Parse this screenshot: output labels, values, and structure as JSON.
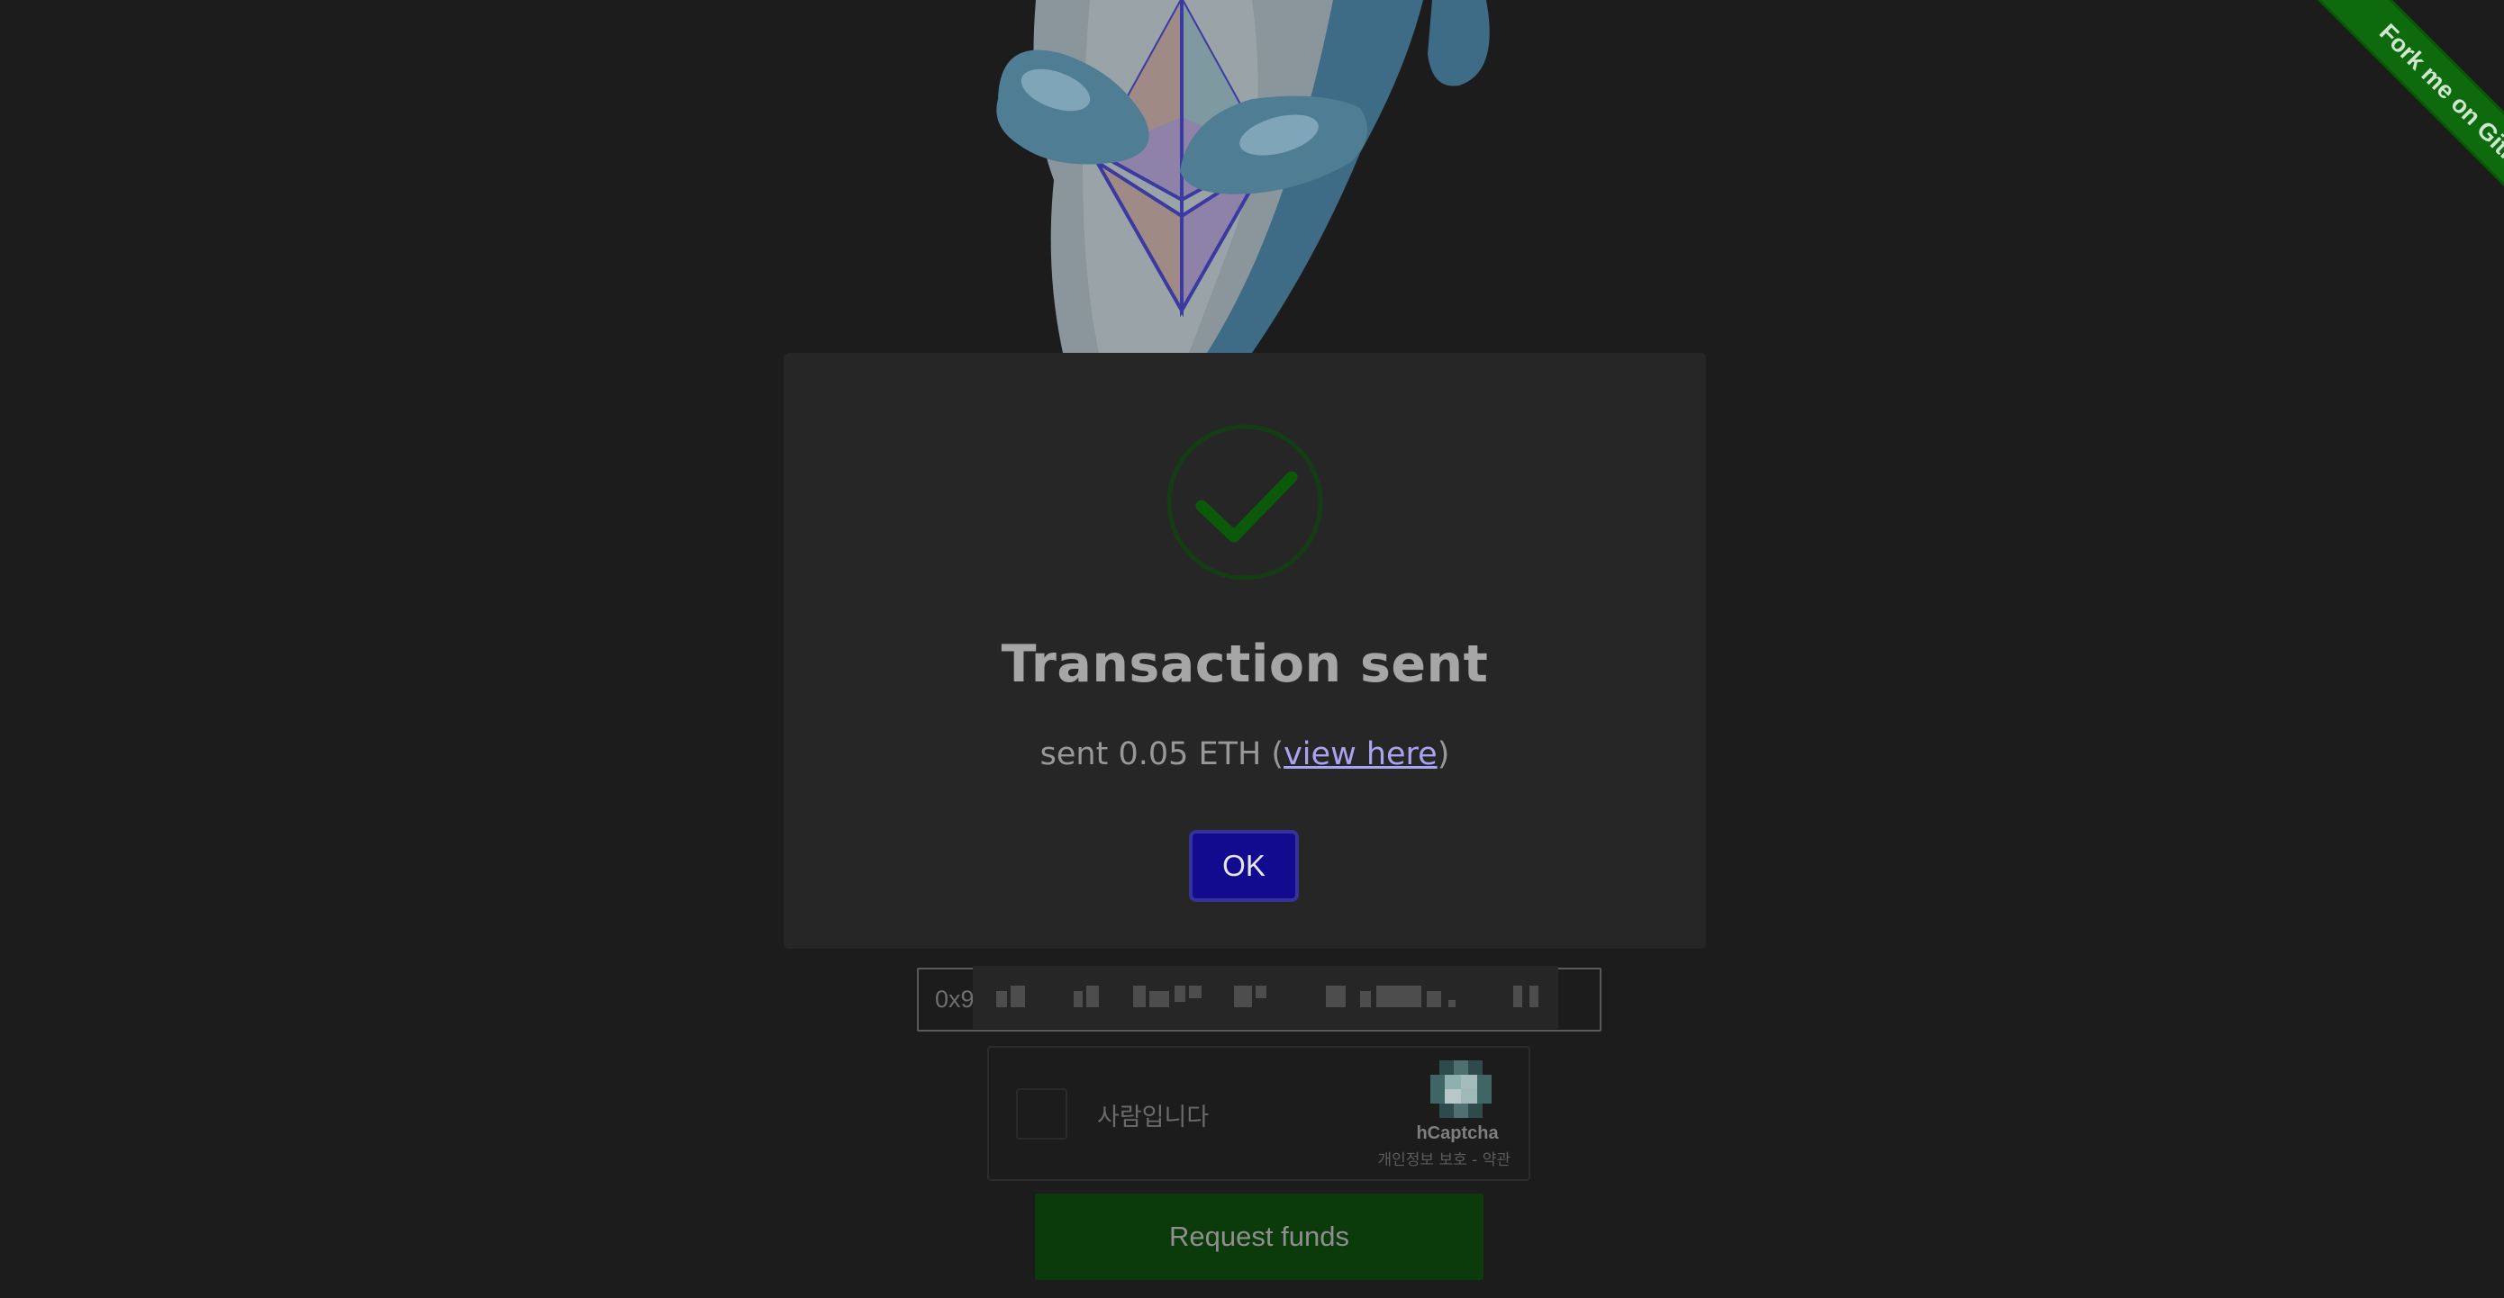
{
  "ribbon": {
    "label": "Fork me on GitHub"
  },
  "modal": {
    "title": "Transaction sent",
    "text_before": "sent 0.05 ETH (",
    "link_label": "view here",
    "text_after": ")",
    "ok_label": "OK"
  },
  "address": {
    "value_prefix": "0x9"
  },
  "captcha": {
    "label": "사람입니다",
    "brand": "hCaptcha",
    "privacy": "개인정보 보호",
    "separator": " - ",
    "terms": "약관"
  },
  "request_button": {
    "label": "Request funds"
  },
  "colors": {
    "background": "#1c1c1c",
    "modal": "#262626",
    "ok_button": "#120a8f",
    "success_green": "#0a5a0a",
    "ribbon": "#0d6b0d",
    "request_button": "#0b3a0b"
  },
  "icons": [
    "mascot-illustration",
    "success-checkmark-icon",
    "hcaptcha-logo-icon"
  ]
}
